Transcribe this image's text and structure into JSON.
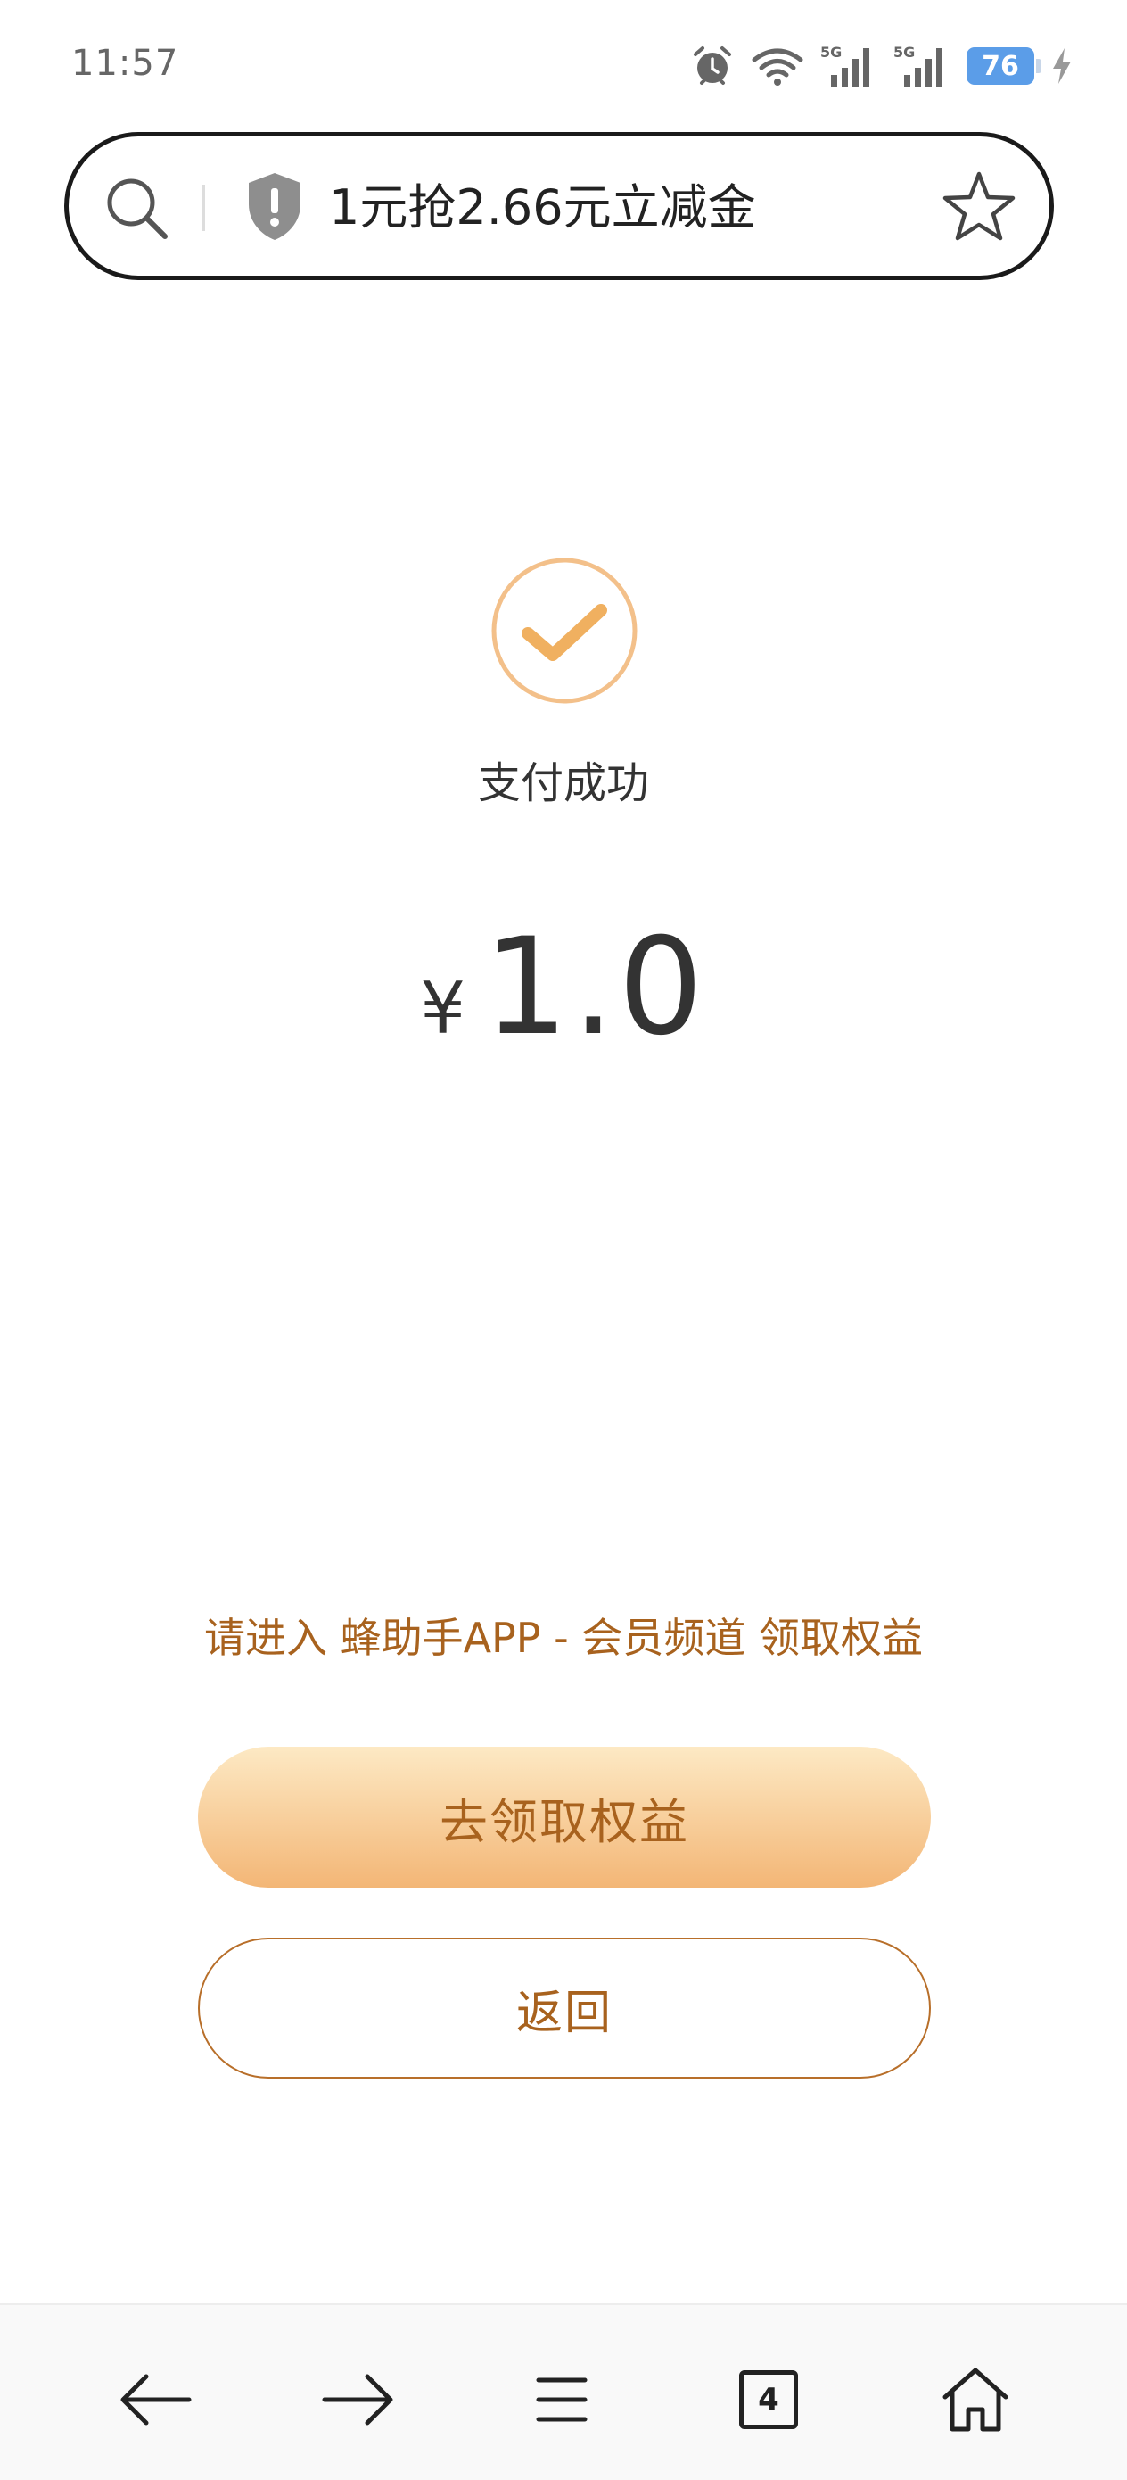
{
  "status_bar": {
    "time": "11:57",
    "signal_1_label": "5G",
    "signal_2_label": "5G",
    "battery_level": "76",
    "icons": [
      "alarm-icon",
      "wifi-icon",
      "signal-5g-icon",
      "signal-5g-icon",
      "battery-icon",
      "charging-icon"
    ]
  },
  "address_bar": {
    "page_title": "1元抢2.66元立减金",
    "icons": [
      "search-icon",
      "shield-warning-icon",
      "star-icon"
    ]
  },
  "result": {
    "icon": "check-circle-icon",
    "status_text": "支付成功",
    "currency_symbol": "¥",
    "amount": "1.0"
  },
  "notice": {
    "text": "请进入 蜂助手APP - 会员频道 领取权益"
  },
  "buttons": {
    "claim_label": "去领取权益",
    "back_label": "返回"
  },
  "bottom_nav": {
    "tab_count": "4",
    "icons": [
      "arrow-left-icon",
      "arrow-right-icon",
      "menu-icon",
      "tabs-icon",
      "home-icon"
    ]
  },
  "colors": {
    "accent_text": "#a8621e",
    "check_color": "#f0b060",
    "button_gradient_top": "#fde9c4",
    "button_gradient_bottom": "#f3b676",
    "battery": "#5b9de8"
  }
}
